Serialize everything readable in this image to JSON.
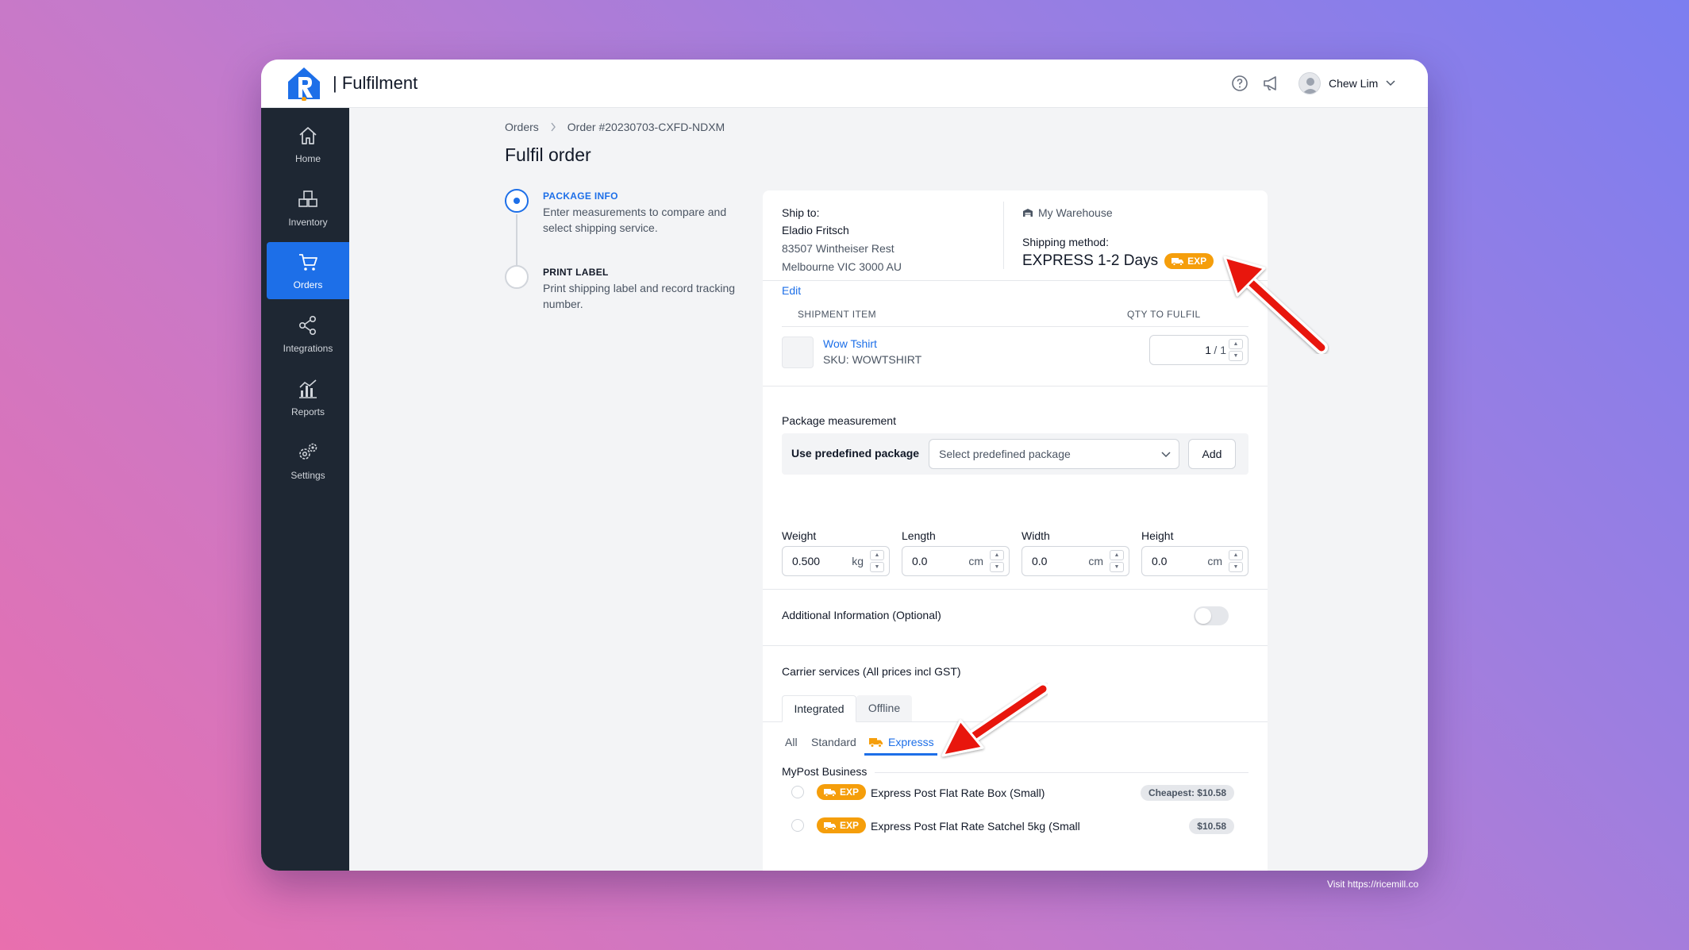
{
  "app": {
    "brand": "| Fulfilment"
  },
  "user": {
    "name": "Chew Lim"
  },
  "sidebar": {
    "items": [
      {
        "label": "Home",
        "icon": "home-icon"
      },
      {
        "label": "Inventory",
        "icon": "inventory-icon"
      },
      {
        "label": "Orders",
        "icon": "cart-icon",
        "active": true
      },
      {
        "label": "Integrations",
        "icon": "share-icon"
      },
      {
        "label": "Reports",
        "icon": "chart-icon"
      },
      {
        "label": "Settings",
        "icon": "gears-icon"
      }
    ]
  },
  "breadcrumb": {
    "root": "Orders",
    "current": "Order #20230703-CXFD-NDXM"
  },
  "page_title": "Fulfil order",
  "steps": [
    {
      "title": "PACKAGE INFO",
      "desc": "Enter measurements to compare and select shipping service.",
      "state": "current"
    },
    {
      "title": "PRINT LABEL",
      "desc": "Print shipping label and record tracking number.",
      "state": "upcoming"
    }
  ],
  "ship_to": {
    "label": "Ship to:",
    "name": "Eladio Fritsch",
    "address1": "83507 Wintheiser Rest",
    "address2": "Melbourne VIC 3000 AU",
    "edit": "Edit"
  },
  "warehouse": {
    "name": "My Warehouse",
    "icon": "warehouse-icon"
  },
  "shipping": {
    "label": "Shipping method:",
    "method": "EXPRESS 1-2 Days",
    "badge": "EXP"
  },
  "shipment_table": {
    "headers": [
      "SHIPMENT ITEM",
      "QTY TO FULFIL"
    ],
    "rows": [
      {
        "name": "Wow Tshirt",
        "sku": "SKU: WOWTSHIRT",
        "qty": "1",
        "qty_total": "/ 1"
      }
    ]
  },
  "package": {
    "title": "Package measurement",
    "predefined_label": "Use predefined package",
    "predefined_placeholder": "Select predefined package",
    "add": "Add",
    "fields": [
      {
        "label": "Weight",
        "value": "0.500",
        "unit": "kg"
      },
      {
        "label": "Length",
        "value": "0.0",
        "unit": "cm"
      },
      {
        "label": "Width",
        "value": "0.0",
        "unit": "cm"
      },
      {
        "label": "Height",
        "value": "0.0",
        "unit": "cm"
      }
    ]
  },
  "additional": {
    "label": "Additional Information (Optional)",
    "enabled": false
  },
  "carrier": {
    "title": "Carrier services (All prices incl GST)",
    "tabs": [
      "Integrated",
      "Offline"
    ],
    "active_tab": "Integrated",
    "filters": [
      "All",
      "Standard",
      "Expresss"
    ],
    "active_filter": "Expresss",
    "group": "MyPost Business",
    "services": [
      {
        "badge": "EXP",
        "name": "Express Post Flat Rate Box (Small)",
        "price": "Cheapest: $10.58"
      },
      {
        "badge": "EXP",
        "name": "Express Post Flat Rate Satchel 5kg (Small",
        "price": "$10.58"
      }
    ]
  },
  "colors": {
    "accent": "#1d6fe8",
    "sidebar": "#1e2733",
    "badge": "#f59e0b",
    "annotation_arrow": "#e8140c"
  },
  "watermark": "Visit https://ricemill.co"
}
